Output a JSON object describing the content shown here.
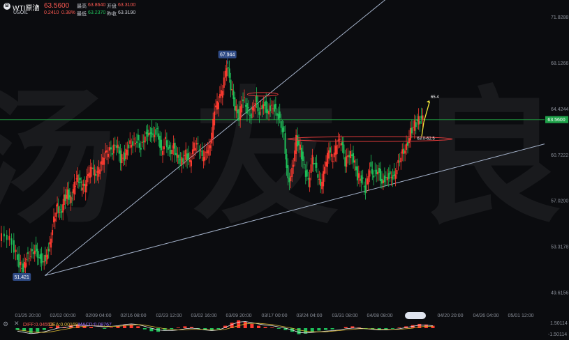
{
  "header": {
    "logo_glyph": "B",
    "symbol": "WTI原油",
    "price": "63.5600",
    "sub_symbol": "USOIL",
    "change": "0.2410",
    "change_pct": "0.38%",
    "high_label": "最高",
    "high_value": "63.8640",
    "open_label": "开盘",
    "open_value": "63.3100",
    "low_label": "最低",
    "low_value": "63.2370",
    "prev_label": "昨收",
    "prev_value": "63.3190"
  },
  "watermark": "汤 友 良",
  "macd_legend": {
    "diff": "DIFF:0.04553",
    "dea": "DEA:0.00169",
    "macd": "MACD:0.08767",
    "right_top": "1.50114",
    "right_bottom": "-1.50114"
  },
  "colors": {
    "up": "#ff3b30",
    "down": "#1fc05a",
    "bg": "#0b0c0f",
    "trend": "#a6b4cc",
    "price_line": "#1e8a3a",
    "ellipse": "#e23a3a",
    "arrow": "#f2e53a",
    "diff_line": "#e8e8e8",
    "dea_line": "#d9b733",
    "macd_color": "#9b6cff"
  },
  "chart_data": {
    "type": "candlestick",
    "symbol": "WTI原油",
    "ylim": [
      48.5,
      73.2
    ],
    "y_ticks": [
      71.8288,
      68.1266,
      64.4244,
      60.7222,
      57.02,
      53.3178,
      49.6156
    ],
    "x_ticks": [
      "01/25 20:00",
      "02/02 00:00",
      "02/09 04:00",
      "02/16 08:00",
      "02/23 12:00",
      "03/02 16:00",
      "03/09 20:00",
      "03/17 00:00",
      "03/24 04:00",
      "03/31 08:00",
      "04/08 08:00",
      "04/20 20:00",
      "04/26 04:00",
      "05/01 12:00"
    ],
    "current_price": 63.56,
    "current_price_label": "63.5600",
    "annotations": {
      "high": {
        "value": 67.944,
        "label": "67.944"
      },
      "low": {
        "value": 51.421,
        "label": "51.421"
      },
      "range_label": "63.0-62.5",
      "target_label": "65.4"
    },
    "price_path": [
      {
        "x": 0.0,
        "y": 54.0
      },
      {
        "x": 1.2,
        "y": 54.2
      },
      {
        "x": 2.2,
        "y": 53.2
      },
      {
        "x": 2.9,
        "y": 52.0
      },
      {
        "x": 3.5,
        "y": 51.6
      },
      {
        "x": 4.0,
        "y": 52.6
      },
      {
        "x": 4.6,
        "y": 52.8
      },
      {
        "x": 5.2,
        "y": 53.2
      },
      {
        "x": 5.8,
        "y": 52.6
      },
      {
        "x": 6.4,
        "y": 52.2
      },
      {
        "x": 6.9,
        "y": 52.6
      },
      {
        "x": 7.4,
        "y": 53.6
      },
      {
        "x": 8.0,
        "y": 55.6
      },
      {
        "x": 8.5,
        "y": 56.6
      },
      {
        "x": 9.0,
        "y": 56.0
      },
      {
        "x": 9.5,
        "y": 57.2
      },
      {
        "x": 10.0,
        "y": 57.6
      },
      {
        "x": 10.5,
        "y": 57.0
      },
      {
        "x": 11.0,
        "y": 58.2
      },
      {
        "x": 11.5,
        "y": 58.8
      },
      {
        "x": 12.0,
        "y": 58.2
      },
      {
        "x": 12.5,
        "y": 58.0
      },
      {
        "x": 13.0,
        "y": 59.0
      },
      {
        "x": 13.6,
        "y": 59.6
      },
      {
        "x": 14.2,
        "y": 59.0
      },
      {
        "x": 14.8,
        "y": 59.6
      },
      {
        "x": 15.4,
        "y": 60.6
      },
      {
        "x": 16.0,
        "y": 61.0
      },
      {
        "x": 16.6,
        "y": 61.0
      },
      {
        "x": 17.2,
        "y": 61.6
      },
      {
        "x": 17.8,
        "y": 60.4
      },
      {
        "x": 18.4,
        "y": 60.6
      },
      {
        "x": 19.0,
        "y": 61.6
      },
      {
        "x": 19.6,
        "y": 61.8
      },
      {
        "x": 20.2,
        "y": 62.0
      },
      {
        "x": 20.8,
        "y": 61.4
      },
      {
        "x": 21.4,
        "y": 62.4
      },
      {
        "x": 22.0,
        "y": 62.6
      },
      {
        "x": 22.6,
        "y": 62.4
      },
      {
        "x": 23.2,
        "y": 62.8
      },
      {
        "x": 23.8,
        "y": 61.0
      },
      {
        "x": 24.4,
        "y": 62.0
      },
      {
        "x": 25.0,
        "y": 61.0
      },
      {
        "x": 25.6,
        "y": 61.4
      },
      {
        "x": 26.2,
        "y": 60.4
      },
      {
        "x": 26.8,
        "y": 60.2
      },
      {
        "x": 27.4,
        "y": 60.8
      },
      {
        "x": 28.0,
        "y": 60.0
      },
      {
        "x": 28.6,
        "y": 61.4
      },
      {
        "x": 29.2,
        "y": 61.4
      },
      {
        "x": 29.8,
        "y": 60.4
      },
      {
        "x": 30.4,
        "y": 60.8
      },
      {
        "x": 31.0,
        "y": 61.4
      },
      {
        "x": 31.6,
        "y": 64.2
      },
      {
        "x": 32.2,
        "y": 65.0
      },
      {
        "x": 32.8,
        "y": 66.0
      },
      {
        "x": 33.4,
        "y": 67.9
      },
      {
        "x": 34.0,
        "y": 66.2
      },
      {
        "x": 34.6,
        "y": 64.6
      },
      {
        "x": 35.2,
        "y": 63.8
      },
      {
        "x": 35.8,
        "y": 65.4
      },
      {
        "x": 36.4,
        "y": 64.4
      },
      {
        "x": 37.0,
        "y": 64.0
      },
      {
        "x": 37.6,
        "y": 65.2
      },
      {
        "x": 38.2,
        "y": 64.2
      },
      {
        "x": 38.8,
        "y": 65.0
      },
      {
        "x": 39.4,
        "y": 64.2
      },
      {
        "x": 40.0,
        "y": 64.8
      },
      {
        "x": 40.6,
        "y": 64.4
      },
      {
        "x": 41.2,
        "y": 63.6
      },
      {
        "x": 41.8,
        "y": 62.4
      },
      {
        "x": 42.4,
        "y": 58.6
      },
      {
        "x": 43.0,
        "y": 59.4
      },
      {
        "x": 43.6,
        "y": 62.0
      },
      {
        "x": 44.2,
        "y": 61.2
      },
      {
        "x": 44.8,
        "y": 59.6
      },
      {
        "x": 45.4,
        "y": 58.4
      },
      {
        "x": 46.0,
        "y": 60.4
      },
      {
        "x": 46.6,
        "y": 59.4
      },
      {
        "x": 47.2,
        "y": 58.0
      },
      {
        "x": 47.8,
        "y": 59.6
      },
      {
        "x": 48.4,
        "y": 61.0
      },
      {
        "x": 49.0,
        "y": 60.2
      },
      {
        "x": 49.6,
        "y": 61.6
      },
      {
        "x": 50.2,
        "y": 61.8
      },
      {
        "x": 50.8,
        "y": 60.0
      },
      {
        "x": 51.4,
        "y": 60.8
      },
      {
        "x": 52.0,
        "y": 60.4
      },
      {
        "x": 52.6,
        "y": 59.0
      },
      {
        "x": 53.2,
        "y": 58.8
      },
      {
        "x": 53.8,
        "y": 58.0
      },
      {
        "x": 54.4,
        "y": 59.8
      },
      {
        "x": 55.0,
        "y": 59.2
      },
      {
        "x": 55.6,
        "y": 59.6
      },
      {
        "x": 56.2,
        "y": 58.6
      },
      {
        "x": 56.8,
        "y": 59.0
      },
      {
        "x": 57.4,
        "y": 59.2
      },
      {
        "x": 58.0,
        "y": 59.0
      },
      {
        "x": 58.6,
        "y": 60.2
      },
      {
        "x": 59.2,
        "y": 61.0
      },
      {
        "x": 59.8,
        "y": 61.4
      },
      {
        "x": 60.4,
        "y": 62.6
      },
      {
        "x": 61.0,
        "y": 63.2
      },
      {
        "x": 61.6,
        "y": 63.5
      },
      {
        "x": 62.2,
        "y": 63.56
      }
    ]
  },
  "macd": {
    "x": [
      0,
      1,
      2,
      3,
      4,
      5,
      6,
      7,
      8,
      9,
      10,
      11,
      12,
      13,
      14,
      15,
      16,
      17,
      18,
      19,
      20,
      21,
      22,
      23,
      24,
      25,
      26,
      27,
      28,
      29,
      30,
      31,
      32,
      33,
      34,
      35,
      36,
      37,
      38,
      39,
      40,
      41,
      42,
      43,
      44,
      45,
      46,
      47,
      48,
      49,
      50,
      51,
      52,
      53,
      54,
      55,
      56,
      57,
      58,
      59,
      60,
      61,
      62
    ],
    "hist": [
      -0.3,
      -0.5,
      -0.8,
      -0.6,
      -0.3,
      0.2,
      0.4,
      0.2,
      0.5,
      0.6,
      0.4,
      0.2,
      0.0,
      -0.1,
      0.1,
      0.3,
      0.5,
      0.6,
      0.3,
      -0.2,
      -0.5,
      -0.6,
      -0.3,
      -0.2,
      0.1,
      0.3,
      0.2,
      -0.1,
      -0.3,
      -0.4,
      -0.2,
      0.4,
      0.9,
      1.3,
      1.1,
      0.7,
      0.4,
      0.2,
      0.1,
      -0.1,
      -0.3,
      -0.6,
      -1.0,
      -0.9,
      -0.6,
      -0.4,
      -0.3,
      -0.2,
      0.0,
      0.2,
      0.3,
      0.1,
      -0.1,
      -0.2,
      -0.3,
      -0.2,
      -0.1,
      0.1,
      0.3,
      0.5,
      0.7,
      0.6,
      0.4
    ],
    "diff": [
      -0.5,
      -0.7,
      -0.9,
      -0.8,
      -0.6,
      -0.3,
      0.0,
      0.1,
      0.3,
      0.5,
      0.5,
      0.4,
      0.3,
      0.2,
      0.3,
      0.4,
      0.6,
      0.7,
      0.6,
      0.3,
      0.0,
      -0.3,
      -0.4,
      -0.4,
      -0.3,
      -0.1,
      0.0,
      -0.1,
      -0.3,
      -0.4,
      -0.3,
      0.1,
      0.6,
      1.0,
      1.1,
      0.9,
      0.7,
      0.5,
      0.4,
      0.2,
      0.0,
      -0.3,
      -0.7,
      -0.8,
      -0.7,
      -0.6,
      -0.5,
      -0.4,
      -0.3,
      -0.1,
      0.0,
      0.0,
      -0.1,
      -0.2,
      -0.3,
      -0.3,
      -0.2,
      -0.1,
      0.1,
      0.3,
      0.5,
      0.5,
      0.4
    ],
    "dea": [
      -0.3,
      -0.4,
      -0.6,
      -0.7,
      -0.7,
      -0.6,
      -0.4,
      -0.2,
      0.0,
      0.2,
      0.3,
      0.4,
      0.4,
      0.3,
      0.3,
      0.3,
      0.4,
      0.5,
      0.6,
      0.5,
      0.3,
      0.1,
      -0.1,
      -0.2,
      -0.3,
      -0.3,
      -0.2,
      -0.2,
      -0.2,
      -0.3,
      -0.3,
      -0.2,
      0.1,
      0.4,
      0.7,
      0.8,
      0.8,
      0.7,
      0.6,
      0.4,
      0.2,
      0.0,
      -0.3,
      -0.5,
      -0.6,
      -0.6,
      -0.6,
      -0.5,
      -0.4,
      -0.3,
      -0.2,
      -0.1,
      -0.1,
      -0.1,
      -0.2,
      -0.2,
      -0.2,
      -0.2,
      -0.1,
      0.0,
      0.2,
      0.3,
      0.3
    ],
    "ylim": [
      -1.50114,
      1.50114
    ]
  }
}
